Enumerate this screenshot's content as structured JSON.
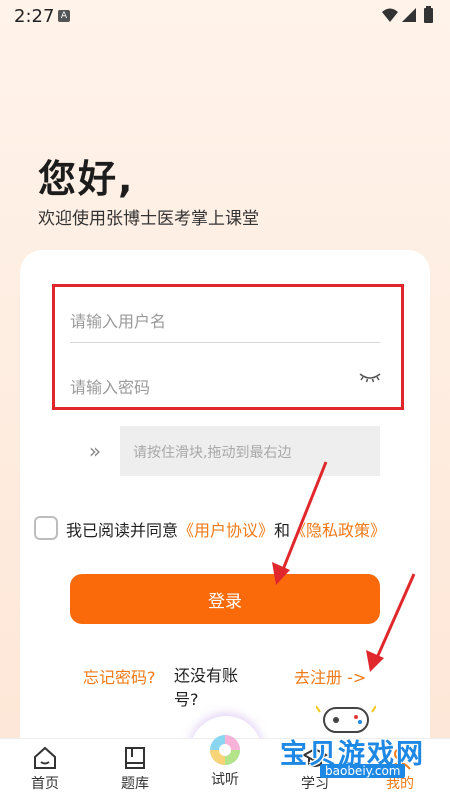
{
  "status_bar": {
    "time": "2:27",
    "notification": "A"
  },
  "greeting": "您好,",
  "subtitle": "欢迎使用张博士医考掌上课堂",
  "form": {
    "username_placeholder": "请输入用户名",
    "password_placeholder": "请输入密码",
    "slider_hint": "请按住滑块,拖动到最右边",
    "slider_handle": "»"
  },
  "agreement": {
    "prefix": "我已阅读并同意",
    "user_agreement": "《用户协议》",
    "and": "和",
    "privacy_policy": "《隐私政策》"
  },
  "login_label": "登录",
  "forgot_password": "忘记密码?",
  "no_account": "还没有账号?",
  "register": "去注册 ->",
  "tabs": {
    "home": "首页",
    "question_bank": "题库",
    "listen": "试听",
    "study": "学习",
    "mine": "我的"
  },
  "watermark": {
    "text": "宝贝游戏网",
    "url": "baobeiy.com"
  },
  "colors": {
    "accent": "#fa6a0a",
    "link": "#f07a18",
    "highlight_box": "#e0282c"
  }
}
